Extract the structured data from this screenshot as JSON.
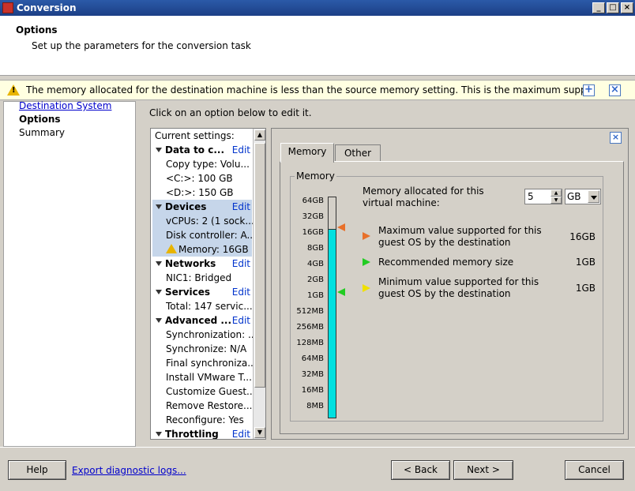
{
  "window": {
    "title": "Conversion",
    "controls": [
      "_",
      "□",
      "×"
    ]
  },
  "header": {
    "title": "Options",
    "subtitle": "Set up the parameters for the conversion task"
  },
  "warning": {
    "text": "The memory allocated for the destination machine is less than the source memory setting. This is the maximum supported fo...",
    "warn_glyph": "!",
    "expand_glyph": "+",
    "close_glyph": "×"
  },
  "nav": {
    "items": [
      {
        "label": "Destination System"
      },
      {
        "label": "Options"
      },
      {
        "label": "Summary"
      }
    ]
  },
  "instruction": "Click on an option below to edit it.",
  "settings": {
    "current": "Current settings:",
    "edit_label": "Edit",
    "data_to_copy": {
      "title": "Data to c...",
      "copy_type": "Copy type: Volu...",
      "c_drive": "<C:>: 100 GB",
      "d_drive": "<D:>: 150 GB"
    },
    "devices": {
      "title": "Devices",
      "vcpus": "vCPUs: 2 (1 sock...",
      "disk_controller": "Disk controller: A...",
      "memory": "Memory: 16GB"
    },
    "networks": {
      "title": "Networks",
      "nic1": "NIC1: Bridged"
    },
    "services": {
      "title": "Services",
      "total": "Total: 147 servic..."
    },
    "advanced": {
      "title": "Advanced ...",
      "sync": "Synchronization: ...",
      "synchronize": "Synchronize: N/A",
      "final_sync": "Final synchroniza...",
      "install_tools": "Install VMware T...",
      "customize": "Customize Guest...",
      "remove_restore": "Remove Restore...",
      "reconfigure": "Reconfigure: Yes"
    },
    "throttling": {
      "title": "Throttling"
    }
  },
  "panel": {
    "tabs": [
      {
        "label": "Memory"
      },
      {
        "label": "Other"
      }
    ],
    "group_title": "Memory",
    "scale_labels": [
      "64GB",
      "32GB",
      "16GB",
      "8GB",
      "4GB",
      "2GB",
      "1GB",
      "512MB",
      "256MB",
      "128MB",
      "64MB",
      "32MB",
      "16MB",
      "8MB"
    ],
    "allocated_label_1": "Memory allocated for this",
    "allocated_label_2": "virtual machine:",
    "allocated_value": "5",
    "allocated_unit": "GB",
    "max_label_1": "Maximum value supported for this",
    "max_label_2": "guest OS by the destination",
    "max_value": "16GB",
    "rec_label": "Recommended memory size",
    "rec_value": "1GB",
    "min_label_1": "Minimum value supported for this",
    "min_label_2": "guest OS by the destination",
    "min_value": "1GB",
    "colors": {
      "max": "#e8702a",
      "recommended": "#22cc22",
      "minimum": "#f0e000",
      "bar": "#00e0e0"
    }
  },
  "footer": {
    "help": "Help",
    "export": "Export diagnostic logs...",
    "back": "< Back",
    "next": "Next >",
    "cancel": "Cancel"
  }
}
